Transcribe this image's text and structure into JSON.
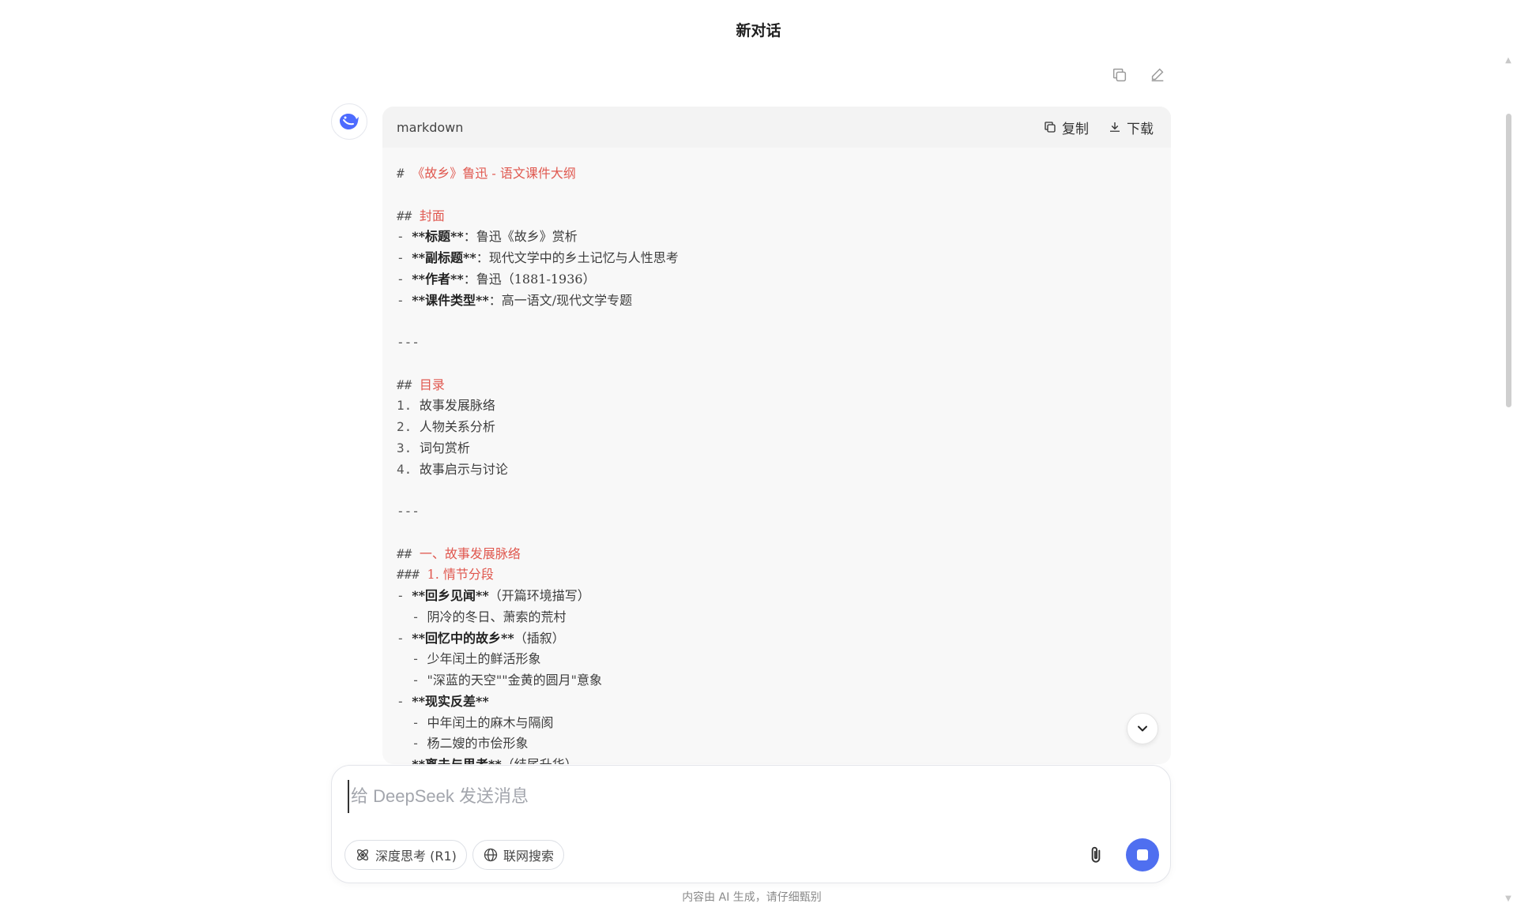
{
  "header": {
    "title": "新对话"
  },
  "top_actions": {
    "copy_icon": "copy-icon",
    "edit_icon": "edit-icon"
  },
  "code_block": {
    "language": "markdown",
    "copy_label": "复制",
    "download_label": "下载",
    "lines": [
      [
        {
          "t": "# ",
          "k": "mk"
        },
        {
          "t": "《故乡》鲁迅 - 语文课件大纲",
          "k": "hd"
        }
      ],
      [],
      [
        {
          "t": "## ",
          "k": "mk"
        },
        {
          "t": "封面",
          "k": "hd"
        }
      ],
      [
        {
          "t": "- ",
          "k": "mk"
        },
        {
          "t": "**标题**",
          "k": "bd"
        },
        {
          "t": "：鲁迅《故乡》赏析",
          "k": "n"
        }
      ],
      [
        {
          "t": "- ",
          "k": "mk"
        },
        {
          "t": "**副标题**",
          "k": "bd"
        },
        {
          "t": "：现代文学中的乡土记忆与人性思考",
          "k": "n"
        }
      ],
      [
        {
          "t": "- ",
          "k": "mk"
        },
        {
          "t": "**作者**",
          "k": "bd"
        },
        {
          "t": "：鲁迅（1881-1936）",
          "k": "n"
        }
      ],
      [
        {
          "t": "- ",
          "k": "mk"
        },
        {
          "t": "**课件类型**",
          "k": "bd"
        },
        {
          "t": "：高一语文/现代文学专题",
          "k": "n"
        }
      ],
      [],
      [
        {
          "t": "---",
          "k": "mk"
        }
      ],
      [],
      [
        {
          "t": "## ",
          "k": "mk"
        },
        {
          "t": "目录",
          "k": "hd"
        }
      ],
      [
        {
          "t": "1. ",
          "k": "mk"
        },
        {
          "t": "故事发展脉络",
          "k": "n"
        }
      ],
      [
        {
          "t": "2. ",
          "k": "mk"
        },
        {
          "t": "人物关系分析",
          "k": "n"
        }
      ],
      [
        {
          "t": "3. ",
          "k": "mk"
        },
        {
          "t": "词句赏析",
          "k": "n"
        }
      ],
      [
        {
          "t": "4. ",
          "k": "mk"
        },
        {
          "t": "故事启示与讨论",
          "k": "n"
        }
      ],
      [],
      [
        {
          "t": "---",
          "k": "mk"
        }
      ],
      [],
      [
        {
          "t": "## ",
          "k": "mk"
        },
        {
          "t": "一、故事发展脉络",
          "k": "hd"
        }
      ],
      [
        {
          "t": "### ",
          "k": "mk"
        },
        {
          "t": "1. 情节分段",
          "k": "hd"
        }
      ],
      [
        {
          "t": "- ",
          "k": "mk"
        },
        {
          "t": "**回乡见闻**",
          "k": "bd"
        },
        {
          "t": "（开篇环境描写）",
          "k": "n"
        }
      ],
      [
        {
          "t": "  - ",
          "k": "mk"
        },
        {
          "t": "阴冷的冬日、萧索的荒村",
          "k": "n"
        }
      ],
      [
        {
          "t": "- ",
          "k": "mk"
        },
        {
          "t": "**回忆中的故乡**",
          "k": "bd"
        },
        {
          "t": "（插叙）",
          "k": "n"
        }
      ],
      [
        {
          "t": "  - ",
          "k": "mk"
        },
        {
          "t": "少年闰土的鲜活形象",
          "k": "n"
        }
      ],
      [
        {
          "t": "  - ",
          "k": "mk"
        },
        {
          "t": "\"深蓝的天空\"\"金黄的圆月\"意象",
          "k": "n"
        }
      ],
      [
        {
          "t": "- ",
          "k": "mk"
        },
        {
          "t": "**现实反差**",
          "k": "bd"
        }
      ],
      [
        {
          "t": "  - ",
          "k": "mk"
        },
        {
          "t": "中年闰土的麻木与隔阂",
          "k": "n"
        }
      ],
      [
        {
          "t": "  - ",
          "k": "mk"
        },
        {
          "t": "杨二嫂的市侩形象",
          "k": "n"
        }
      ],
      [
        {
          "t": "- ",
          "k": "mk"
        },
        {
          "t": "**离去与思考**",
          "k": "bd"
        },
        {
          "t": "（结尾升华）",
          "k": "n"
        }
      ]
    ]
  },
  "composer": {
    "placeholder": "给 DeepSeek 发送消息",
    "value": "",
    "deep_think_label": "深度思考 (R1)",
    "web_search_label": "联网搜索"
  },
  "footer": {
    "disclaimer": "内容由 AI 生成，请仔细甄别"
  },
  "colors": {
    "accent": "#4f6ff0",
    "heading": "#e0584f"
  }
}
